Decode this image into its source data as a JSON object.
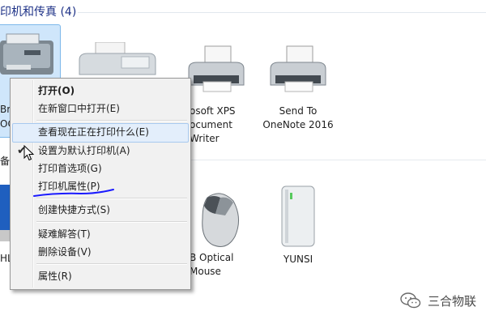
{
  "section": {
    "title": "印机和传真 (4)"
  },
  "devices": [
    {
      "label": "osoft XPS\nocument\nWriter"
    },
    {
      "label": "Send To\nOneNote 2016"
    },
    {
      "label": "B Optical\nMouse"
    },
    {
      "label": "YUNSI"
    }
  ],
  "partial": {
    "left1": "Br",
    "left2": "OC",
    "left3": "备",
    "left4": "HL"
  },
  "context_menu": {
    "items": [
      {
        "label": "打开(O)"
      },
      {
        "label": "在新窗口中打开(E)"
      },
      {
        "label": "查看现在正在打印什么(E)"
      },
      {
        "label": "设置为默认打印机(A)"
      },
      {
        "label": "打印首选项(G)"
      },
      {
        "label": "打印机属性(P)"
      },
      {
        "label": "创建快捷方式(S)"
      },
      {
        "label": "疑难解答(T)"
      },
      {
        "label": "删除设备(V)"
      },
      {
        "label": "属性(R)"
      }
    ],
    "checked_item": "设置为默认打印机(A)",
    "checkmark": "✔"
  },
  "watermark": {
    "text": "三合物联",
    "icon": "wechat-icon"
  },
  "colors": {
    "header": "#1e3287",
    "selection": "#cfe6fb",
    "annotation": "#1a1aff"
  }
}
